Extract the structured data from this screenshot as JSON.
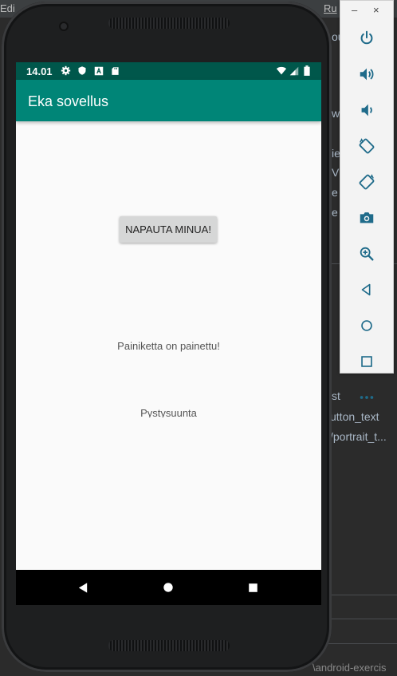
{
  "ide": {
    "menu": {
      "edit": "Edi",
      "run": "Ru"
    },
    "code_fragments": {
      "line1": "ou",
      "line2": "w",
      "line3": "ie",
      "line4": "V",
      "line5": "e",
      "line6": "e",
      "line7": "st",
      "line8": "utton_text",
      "line9": "/portrait_t...",
      "footer": "\\android-exercis"
    }
  },
  "phone": {
    "status_bar": {
      "time": "14.01",
      "icons": [
        "gear-icon",
        "shield-icon",
        "a-icon",
        "sd-card-icon",
        "wifi-icon",
        "signal-icon",
        "battery-icon"
      ]
    },
    "app_bar": {
      "title": "Eka sovellus"
    },
    "content": {
      "button_label": "NAPAUTA MINUA!",
      "status_message": "Painiketta on painettu!",
      "orientation_text": "Pystysuunta"
    },
    "nav_bar": {
      "buttons": [
        "back-icon",
        "home-icon",
        "recents-icon"
      ]
    },
    "colors": {
      "primary": "#008577",
      "primary_dark": "#00574b",
      "background": "#fafafa"
    }
  },
  "emulator_toolbar": {
    "window_controls": {
      "minimize": "–",
      "close": "×"
    },
    "buttons": [
      "power-icon",
      "volume-up-icon",
      "volume-down-icon",
      "rotate-left-icon",
      "rotate-right-icon",
      "camera-icon",
      "zoom-icon",
      "back-icon",
      "home-icon",
      "overview-icon",
      "more-icon"
    ]
  }
}
